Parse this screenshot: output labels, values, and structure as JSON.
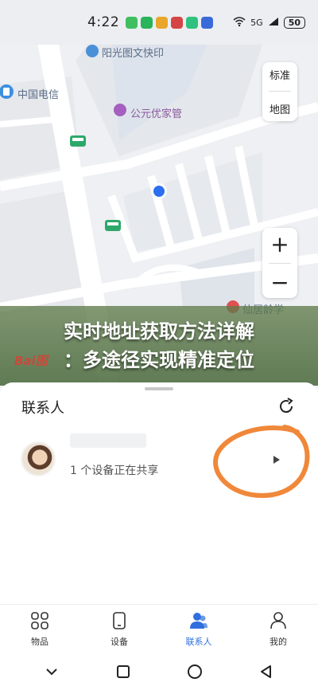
{
  "status_bar": {
    "time": "4:22",
    "network": "5G",
    "battery": "50",
    "app_icon_colors": [
      "#3fbf5f",
      "#29b35a",
      "#e8a62a",
      "#d64545",
      "#2ec27e",
      "#3a6ad9",
      "#777777"
    ]
  },
  "map": {
    "pois": {
      "print_shop": "阳光图文快印",
      "telecom": "中国电信",
      "store": "公元优家管",
      "partial_label": "仙居龄学"
    },
    "map_type": {
      "standard": "标准",
      "map": "地图"
    },
    "zoom": {
      "in": "+",
      "out": "−"
    }
  },
  "overlay": {
    "line1": "实时地址获取方法详解",
    "line2": "：多途径实现精准定位",
    "logo": "Bai图"
  },
  "sheet": {
    "title": "联系人",
    "contact": {
      "name": "",
      "status": "1 个设备正在共享"
    }
  },
  "tabs": [
    {
      "label": "物品",
      "icon": "grid-icon"
    },
    {
      "label": "设备",
      "icon": "device-icon"
    },
    {
      "label": "联系人",
      "icon": "contacts-icon",
      "active": true
    },
    {
      "label": "我的",
      "icon": "profile-icon"
    }
  ],
  "colors": {
    "accent": "#2f6fde",
    "location_dot": "#2c6ff0",
    "annotation": "#f0883a",
    "overlay": "#5d7a48"
  }
}
